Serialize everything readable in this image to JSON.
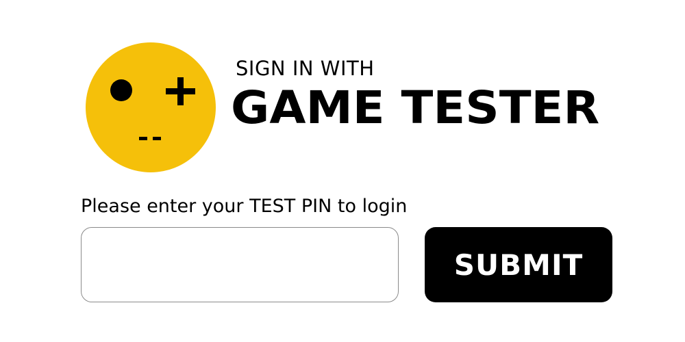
{
  "logo": {
    "icon": "gamepad-face-icon",
    "face_color": "#f5c00a",
    "feature_color": "#000000"
  },
  "header": {
    "subtitle": "SIGN IN WITH",
    "title": "GAME TESTER"
  },
  "form": {
    "prompt": "Please enter your TEST PIN to login",
    "pin_value": "",
    "pin_placeholder": "",
    "submit_label": "SUBMIT"
  },
  "colors": {
    "accent": "#f5c00a",
    "button_bg": "#000000",
    "button_text": "#ffffff",
    "input_border": "#8a8a8a"
  }
}
